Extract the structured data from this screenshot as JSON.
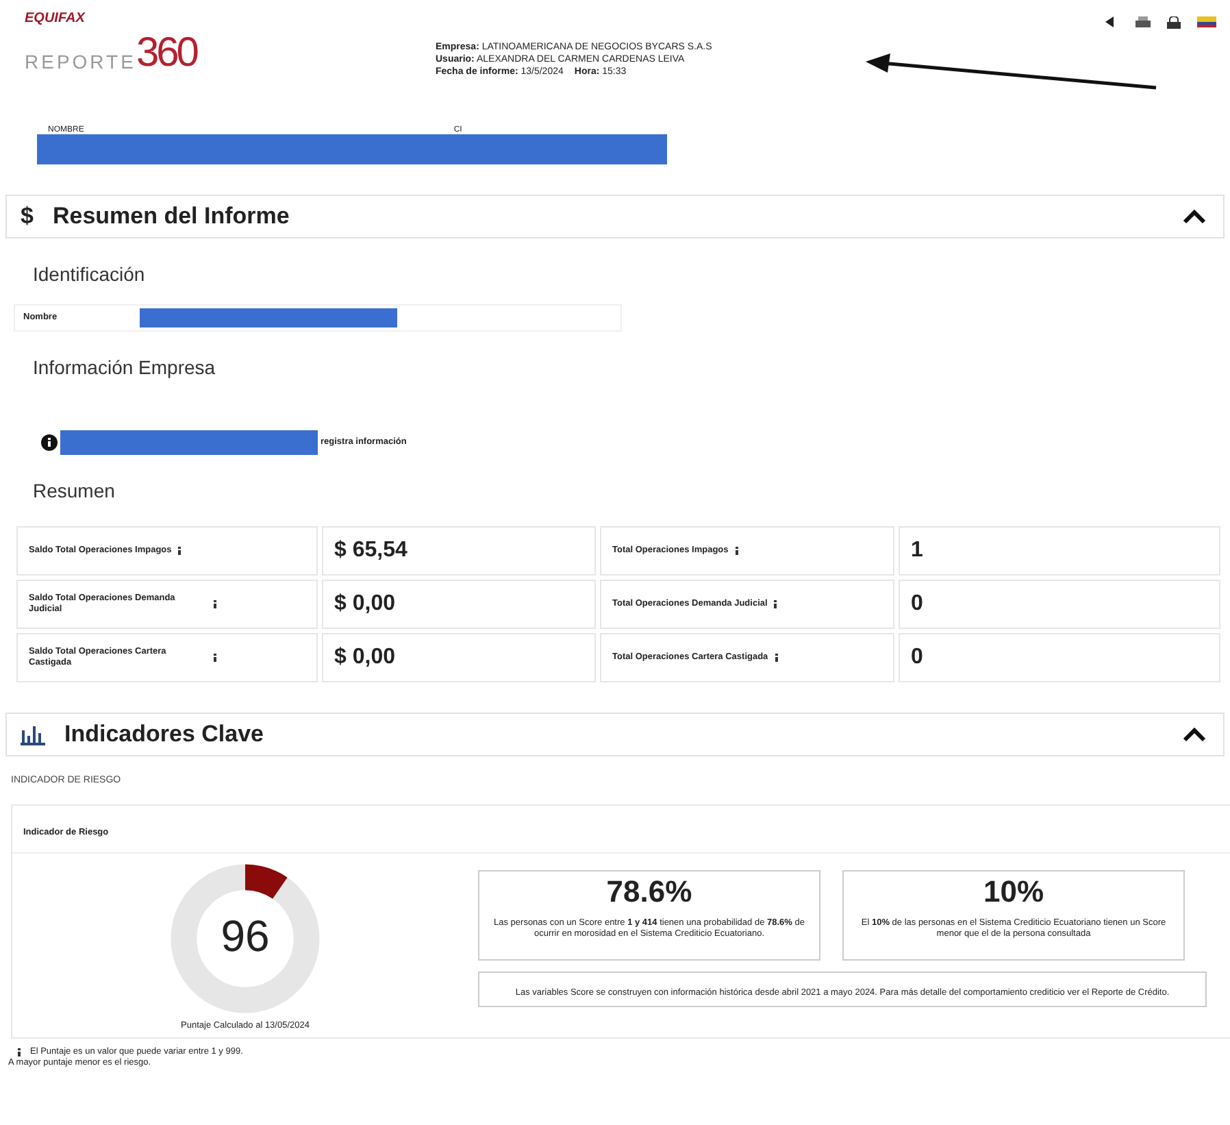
{
  "header": {
    "logo": "EQUIFAX",
    "product": {
      "word": "REPORTE",
      "number": "360"
    },
    "meta": [
      [
        {
          "label": "Empresa:",
          "value": "LATINOAMERICANA DE NEGOCIOS BYCARS S.A.S"
        }
      ],
      [
        {
          "label": "Usuario:",
          "value": "ALEXANDRA DEL CARMEN CARDENAS LEIVA"
        }
      ],
      [
        {
          "label": "Fecha de informe:",
          "value": "13/5/2024"
        },
        {
          "label": "Hora:",
          "value": "15:33"
        }
      ]
    ],
    "subject_labels": [
      "NOMBRE",
      "CI"
    ]
  },
  "summary": {
    "title": "Resumen del Informe",
    "icon": "$",
    "expanded": true,
    "identification": {
      "title": "Identificación",
      "label": "Nombre"
    },
    "company": {
      "title": "Información Empresa",
      "note": "registra información"
    },
    "resumen": {
      "title": "Resumen",
      "rows": [
        {
          "label": "Saldo Total Operaciones Impagos",
          "value": "$ 65,54",
          "label2": "Total Operaciones Impagos",
          "value2": "1"
        },
        {
          "label": "Saldo Total Operaciones Demanda Judicial",
          "value": "$ 0,00",
          "label2": "Total Operaciones Demanda Judicial",
          "value2": "0"
        },
        {
          "label": "Saldo Total Operaciones Cartera Castigada",
          "value": "$ 0,00",
          "label2": "Total Operaciones Cartera Castigada",
          "value2": "0"
        }
      ]
    }
  },
  "indicators": {
    "title": "Indicadores Clave",
    "expanded": true,
    "subtitle": "INDICADOR DE RIESGO",
    "panel_title": "Indicador de Riesgo",
    "score": "96",
    "level": 0.096,
    "score_date": "Puntaje Calculado al 13/05/2024",
    "cards": [
      {
        "value": "78.6%",
        "text": "Las personas con un Score entre **1 y 414** tienen una probabilidad de **78.6%** de ocurrir en morosidad en el Sistema Crediticio Ecuatoriano."
      },
      {
        "value": "10%",
        "text": "El **10%** de las personas en el Sistema Crediticio Ecuatoriano tienen un Score menor que el de la persona consultada"
      }
    ],
    "note": "Las variables Score se construyen con información histórica desde abril 2021 a mayo 2024. Para más detalle del comportamiento crediticio ver el Reporte de Crédito.",
    "footnote": [
      "El Puntaje es un valor que puede variar entre 1 y 999.",
      "A mayor puntaje menor es el riesgo."
    ]
  }
}
